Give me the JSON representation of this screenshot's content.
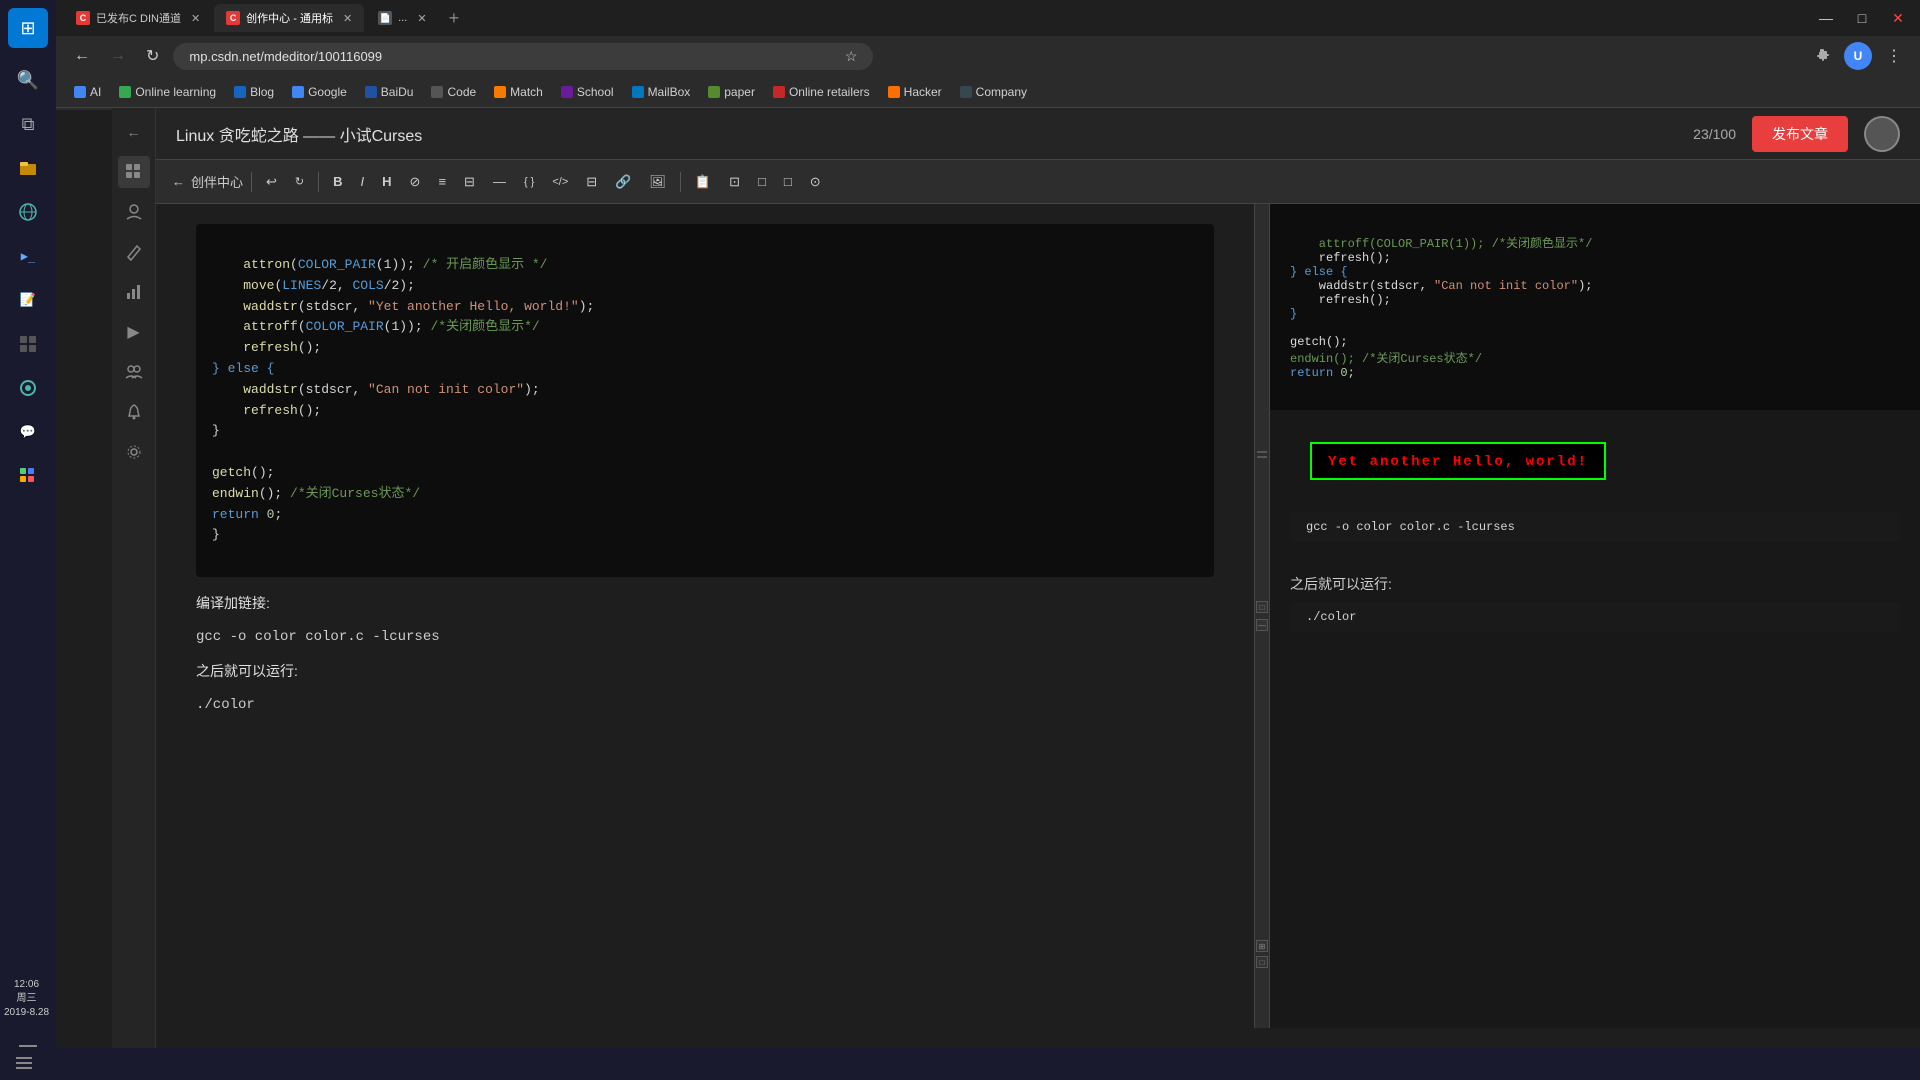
{
  "os": {
    "taskbar": {
      "items": [
        {
          "name": "start-button",
          "icon": "⊞",
          "label": "Start"
        },
        {
          "name": "search-icon",
          "icon": "🔍",
          "label": "Search"
        },
        {
          "name": "taskview-icon",
          "icon": "⧉",
          "label": "Task View"
        },
        {
          "name": "file-icon",
          "icon": "📁",
          "label": "File Explorer"
        },
        {
          "name": "browser-icon",
          "icon": "🌐",
          "label": "Browser"
        },
        {
          "name": "terminal-icon",
          "icon": "▶",
          "label": "Terminal"
        },
        {
          "name": "notepad-icon",
          "icon": "📝",
          "label": "Notepad"
        },
        {
          "name": "settings-icon",
          "icon": "⚙",
          "label": "Settings"
        }
      ],
      "clock": {
        "time": "12:06",
        "day": "周三",
        "date": "2019-8.28"
      }
    }
  },
  "browser": {
    "tabs": [
      {
        "id": "tab1",
        "favicon_color": "#e53935",
        "title": "已发布C DIN通道",
        "active": false
      },
      {
        "id": "tab2",
        "favicon_color": "#e53935",
        "title": "创作中心 - 通用标",
        "active": true
      },
      {
        "id": "tab3",
        "favicon_color": "#555",
        "title": "...",
        "active": false
      }
    ],
    "address": "mp.csdn.net/mdeditor/100116099",
    "bookmarks": [
      {
        "label": "AI",
        "color": "#4285f4"
      },
      {
        "label": "Online learning",
        "color": "#34a853"
      },
      {
        "label": "Blog",
        "color": "#1565c0"
      },
      {
        "label": "Google",
        "color": "#4285f4"
      },
      {
        "label": "BaiDu",
        "color": "#2052a4"
      },
      {
        "label": "Code",
        "color": "#555"
      },
      {
        "label": "Match",
        "color": "#f57c00"
      },
      {
        "label": "School",
        "color": "#6a1b9a"
      },
      {
        "label": "MailBox",
        "color": "#0277bd"
      },
      {
        "label": "paper",
        "color": "#558b2f"
      },
      {
        "label": "Online retailers",
        "color": "#c62828"
      },
      {
        "label": "Hacker",
        "color": "#ff6f00"
      },
      {
        "label": "Company",
        "color": "#37474f"
      }
    ]
  },
  "editor": {
    "title": "Linux 贪吃蛇之路 —— 小试Curses",
    "word_count": "23/100",
    "publish_btn": "发布文章",
    "partner_center": "创伴中心",
    "toolbar_buttons": [
      "B",
      "I",
      "H",
      "⊘",
      "≡",
      "⊟",
      "—",
      "{ }",
      "</>",
      "⊟",
      "🔗",
      "🖼",
      "📋",
      "⊡",
      "□",
      "□",
      "⊙"
    ],
    "left_code": [
      "    attron(COLOR_PAIR(1)); /* 开启颜色显示 */",
      "    move(LINES/2, COLS/2);",
      "    waddstr(stdscr, \"Yet another Hello, world!\");",
      "    attroff(COLOR_PAIR(1)); /*关闭颜色显示*/",
      "    refresh();",
      "} else {",
      "    waddstr(stdscr, \"Can not init color\");",
      "    refresh();",
      "}",
      "",
      "getch();",
      "endwin(); /*关闭Curses状态*/",
      "return 0;",
      "}"
    ],
    "section_compile": "编译加链接:",
    "compile_cmd": "gcc -o color color.c -lcurses",
    "section_run": "之后就可以运行:",
    "run_cmd": "./color",
    "right_code": [
      "    attroff(COLOR_PAIR(1)); /*关闭颜色显示*/",
      "    refresh();",
      "} else {",
      "    waddstr(stdscr, \"Can not init color\");",
      "    refresh();",
      "}",
      "",
      "getch();",
      "endwin(); /*关闭Curses状态*/",
      "return 0;"
    ],
    "terminal_output": "Yet another Hello, world!",
    "right_compile_cmd": "gcc -o color color.c -lcurses",
    "right_section_run": "之后就可以运行:",
    "right_run_cmd": "./color",
    "status_url": "https://blog.csdn.net/weixin_43336289"
  }
}
